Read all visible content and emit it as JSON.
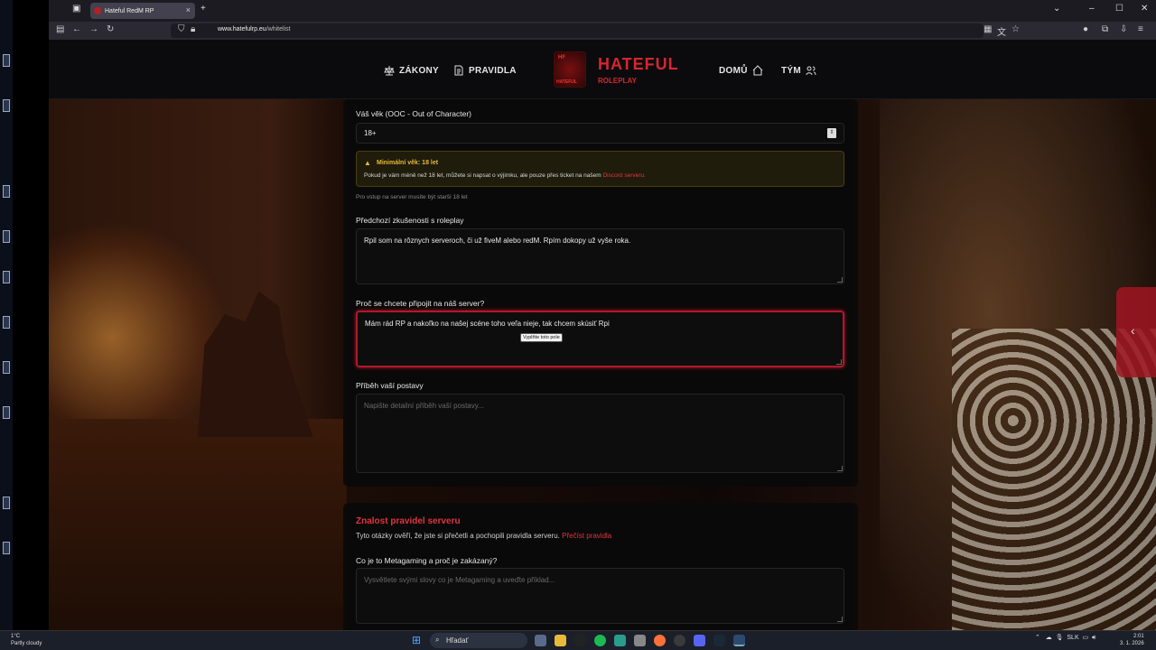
{
  "browser": {
    "tab_title": "Hateful RedM RP",
    "url_domain": "www.hatefulrp.eu",
    "url_path": "/whitelist"
  },
  "header": {
    "nav_left": [
      "ZÁKONY",
      "PRAVIDLA"
    ],
    "nav_right": [
      "DOMŮ",
      "TÝM"
    ],
    "logo_title": "HATEFUL",
    "logo_sub": "ROLEPLAY",
    "badge_top": "HF",
    "badge_bottom": "HATEFUL"
  },
  "form": {
    "age_label": "Váš věk (OOC - Out of Character)",
    "age_value": "18+",
    "warn_title": "Minimální věk: 18 let",
    "warn_text": "Pokud je vám méně než 18 let, můžete si napsat o výjimku, ale pouze přes ticket na našem",
    "warn_link": "Discord serveru.",
    "age_hint": "Pro vstup na server musíte být starší 18 let",
    "exp_label": "Předchozí zkušenosti s roleplay",
    "exp_value": "Rpil som na rôznych serveroch, či už fiveM alebo redM. Rpím dokopy už vyše roka.",
    "why_label": "Proč se chcete připojit na náš server?",
    "why_value": "Mám rád RP a nakoľko na našej scéne toho veľa nieje, tak chcem skúsiť Rpi",
    "tooltip": "Vyplňte toto pole",
    "story_label": "Příběh vaší postavy",
    "story_placeholder": "Napište detailní příběh vaší postavy..."
  },
  "rules": {
    "title": "Znalost pravidel serveru",
    "desc": "Tyto otázky ověří, že jste si přečetli a pochopili pravidla serveru.",
    "link": "Přečíst pravidla",
    "q1_label": "Co je to Metagaming a proč je zakázaný?",
    "q1_placeholder": "Vysvětlete svými slovy co je Metagaming a uveďte příklad..."
  },
  "taskbar": {
    "temp": "1°C",
    "weather": "Partly cloudy",
    "search": "Hľadať",
    "lang": "SLK",
    "time": "2:01",
    "date": "3. 1. 2026"
  },
  "colors": {
    "accent": "#d6262f",
    "warning": "#e8b93a"
  }
}
